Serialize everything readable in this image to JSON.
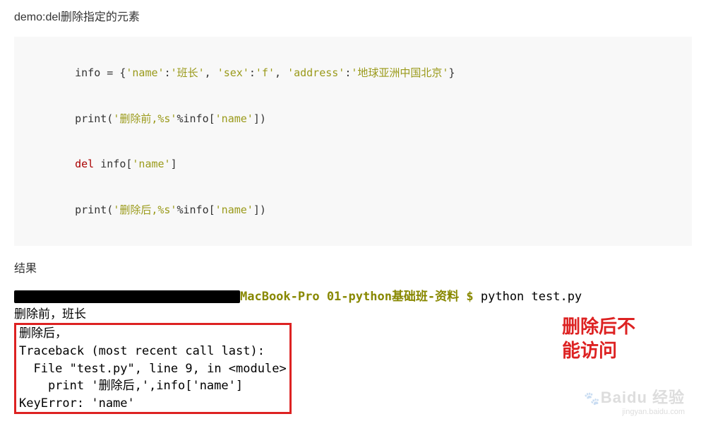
{
  "title": "demo:del删除指定的元素",
  "code": {
    "l1a": "    info = {",
    "l1b": "'name'",
    "l1c": ":",
    "l1d": "'班长'",
    "l1e": ", ",
    "l1f": "'sex'",
    "l1g": ":",
    "l1h": "'f'",
    "l1i": ", ",
    "l1j": "'address'",
    "l1k": ":",
    "l1l": "'地球亚洲中国北京'",
    "l1m": "}",
    "l2a": "    print(",
    "l2b": "'删除前,%s'",
    "l2c": "%info[",
    "l2d": "'name'",
    "l2e": "])",
    "l3a": "    ",
    "l3b": "del",
    "l3c": " info[",
    "l3d": "'name'",
    "l3e": "]",
    "l4a": "    print(",
    "l4b": "'删除后,%s'",
    "l4c": "%info[",
    "l4d": "'name'",
    "l4e": "])"
  },
  "result_label": "结果",
  "terminal": {
    "prompt_host": "MacBook-Pro 01-python基础班-资料 $ ",
    "prompt_cmd": "python test.py",
    "out1": "删除前，班长",
    "err1": "删除后，",
    "err2": "Traceback (most recent call last):",
    "err3": "  File \"test.py\", line 9, in <module>",
    "err4": "    print '删除后,',info['name']",
    "err5": "KeyError: 'name'"
  },
  "annotation": {
    "line1": "删除后不",
    "line2": "能访问"
  },
  "watermark": {
    "main": "Baidu 经验",
    "sub": "jingyan.baidu.com"
  }
}
